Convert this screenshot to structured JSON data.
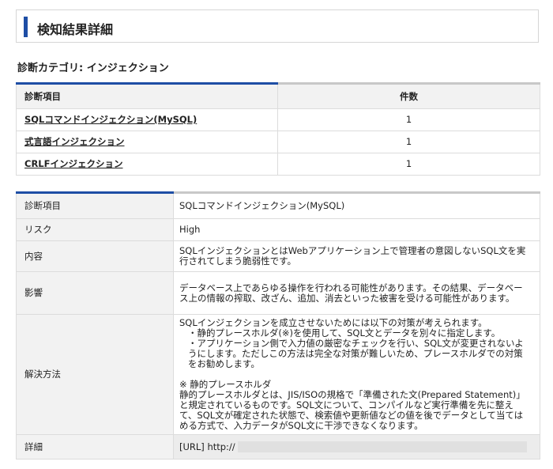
{
  "page": {
    "title": "検知結果詳細"
  },
  "category_label": "診断カテゴリ: インジェクション",
  "summary": {
    "header": {
      "item": "診断項目",
      "count": "件数"
    },
    "rows": [
      {
        "name": "SQLコマンドインジェクション(MySQL)",
        "count": "1"
      },
      {
        "name": "式言語インジェクション",
        "count": "1"
      },
      {
        "name": "CRLFインジェクション",
        "count": "1"
      }
    ]
  },
  "detail": {
    "item_label": "診断項目",
    "item_value": "SQLコマンドインジェクション(MySQL)",
    "risk_label": "リスク",
    "risk_value": "High",
    "content_label": "内容",
    "content_value": "SQLインジェクションとはWebアプリケーション上で管理者の意図しないSQL文を実行されてしまう脆弱性です。",
    "impact_label": "影響",
    "impact_value": "データベース上であらゆる操作を行われる可能性があります。その結果、データベース上の情報の搾取、改ざん、追加、消去といった被害を受ける可能性があります。",
    "solution_label": "解決方法",
    "solution": {
      "intro": "SQLインジェクションを成立させないためには以下の対策が考えられます。",
      "point1": "・静的プレースホルダ(※)を使用して、SQL文とデータを別々に指定します。",
      "point2": "・アプリケーション側で入力値の厳密なチェックを行い、SQL文が変更されないようにします。ただしこの方法は完全な対策が難しいため、プレースホルダでの対策をお勧めします。",
      "note_title": "※ 静的プレースホルダ",
      "note_body": "静的プレースホルダとは、JIS/ISOの規格で「準備された文(Prepared Statement)」と規定されているものです。SQL文について、コンパイルなど実行準備を先に整えて、SQL文が確定された状態で、検索値や更新値などの値を後でデータとして当てはめる方式で、入力データがSQL文に干渉できなくなります。"
    },
    "details_label": "詳細",
    "details_value": "[URL] http://"
  }
}
